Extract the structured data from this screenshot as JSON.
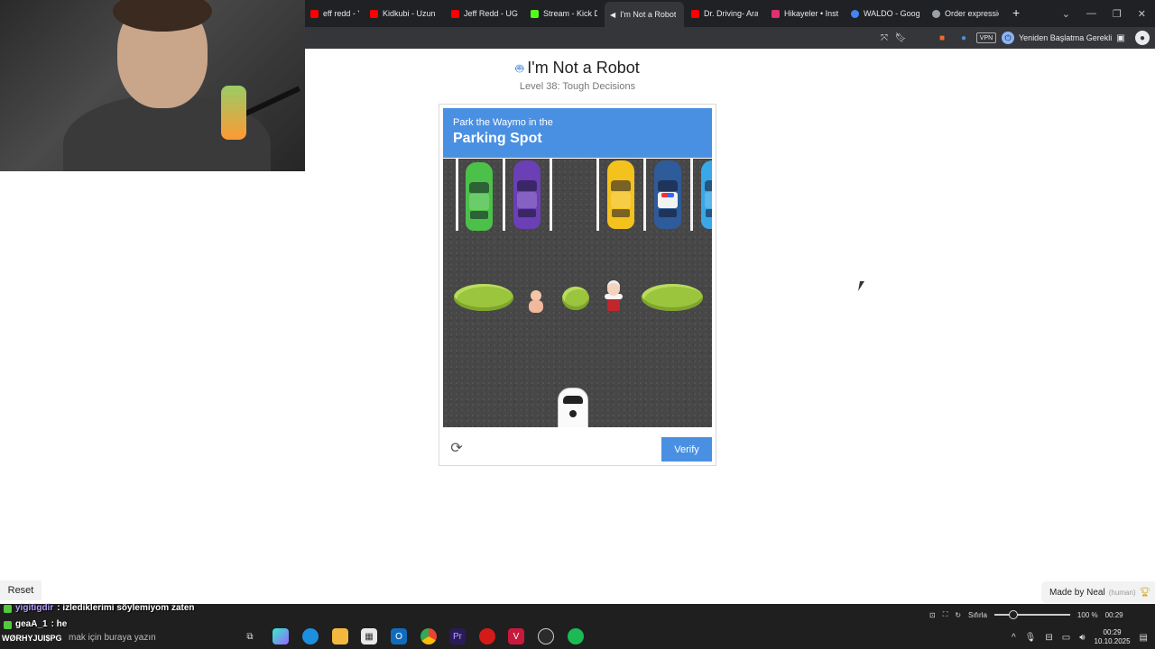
{
  "browser": {
    "tabs": [
      {
        "title": "eff redd - YouTub",
        "color": "#ff0000"
      },
      {
        "title": "Kidkubi - Uzun Bi",
        "color": "#ff0000"
      },
      {
        "title": "Jeff Redd - UGU C",
        "color": "#ff0000"
      },
      {
        "title": "Stream - Kick Das",
        "color": "#53fc18"
      },
      {
        "title": "I'm Not a Robot",
        "color": "#e8eaed"
      },
      {
        "title": "Dr. Driving- Araba",
        "color": "#ff0000"
      },
      {
        "title": "Hikayeler • Instag",
        "color": "#e1306c"
      },
      {
        "title": "WALDO - Google",
        "color": "#4285f4"
      },
      {
        "title": "Order expressions",
        "color": "#9aa0a6"
      }
    ],
    "new_tab": "+",
    "restart_label": "Yeniden Başlatma Gerekli",
    "vpn_label": "VPN"
  },
  "page": {
    "title": "I'm Not a Robot",
    "subtitle": "Level 38: Tough Decisions"
  },
  "captcha": {
    "instruction_line1": "Park the Waymo in the",
    "instruction_line2": "Parking Spot",
    "verify_label": "Verify",
    "refresh_icon": "refresh-icon",
    "parked_cars": [
      {
        "color": "#4cc14a",
        "type": "car"
      },
      {
        "color": "#6b3fb5",
        "type": "car"
      },
      {
        "color": null,
        "type": "empty-spot"
      },
      {
        "color": "#f4c21d",
        "type": "car"
      },
      {
        "color": "#2e5b9a",
        "type": "police"
      },
      {
        "color": "#3aa7e8",
        "type": "car"
      }
    ],
    "obstacles": [
      "bush",
      "baby",
      "bush",
      "granny",
      "bush"
    ]
  },
  "footer": {
    "reset_label": "Reset",
    "made_by": "Made by Neal",
    "made_by_suffix": "(human)"
  },
  "chat": {
    "messages": [
      {
        "user": "yigitigdir",
        "text": ": izlediklerimi söylemiyom zaten"
      },
      {
        "user": "geaA_1",
        "text": ": he"
      }
    ],
    "overlay_tag": "WØRHYJUI$PG"
  },
  "taskbar": {
    "search_placeholder": "mak için buraya yazın",
    "zoom_label": "Sıfırla",
    "zoom_value": "100 %",
    "zoom_fraction": 0.25,
    "time_short": "00:29",
    "time": "00:29",
    "date": "10.10.2025"
  }
}
